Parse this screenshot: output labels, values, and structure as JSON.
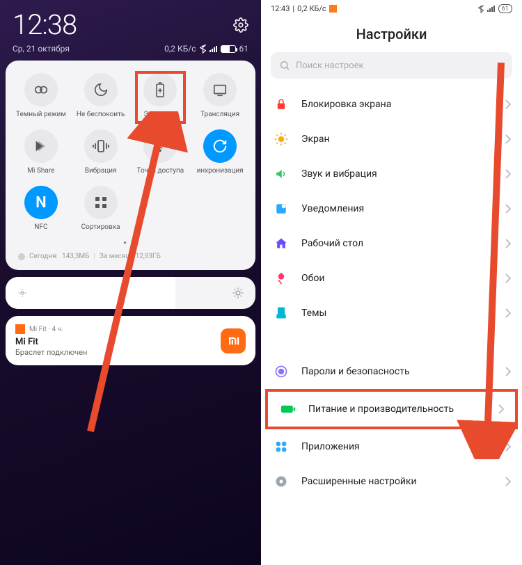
{
  "left": {
    "time": "12:38",
    "date": "Ср, 21 октября",
    "net_speed": "0,2 КБ/с",
    "battery": "61",
    "tiles": [
      {
        "id": "dark-mode",
        "label": "Темный режим",
        "active": false
      },
      {
        "id": "dnd",
        "label": "Не беспокоить",
        "active": false
      },
      {
        "id": "battery-saver",
        "label": "Экономия",
        "active": false,
        "highlight": true
      },
      {
        "id": "cast",
        "label": "Трансляция",
        "active": false
      },
      {
        "id": "mi-share",
        "label": "Mi Share",
        "active": false
      },
      {
        "id": "vibration",
        "label": "Вибрация",
        "active": false
      },
      {
        "id": "hotspot",
        "label": "Точка доступа",
        "active": false
      },
      {
        "id": "sync",
        "label": "инхронизация",
        "active": true
      },
      {
        "id": "nfc",
        "label": "NFC",
        "active": true
      },
      {
        "id": "edit",
        "label": "Сортировка",
        "active": false
      }
    ],
    "data_today_label": "Сегодня:",
    "data_today": "143,3МБ",
    "data_month_label": "За месяц:",
    "data_month": "12,93ГБ",
    "notif": {
      "app": "Mi Fit",
      "age": "4 ч.",
      "sep": "·",
      "title": "Mi Fit",
      "body": "Браслет подключен"
    }
  },
  "right": {
    "status_time": "12:43",
    "status_net": "0,2 КБ/с",
    "status_sep": "|",
    "battery": "61",
    "title": "Настройки",
    "search_placeholder": "Поиск настроек",
    "items": [
      {
        "id": "lock",
        "label": "Блокировка экрана",
        "color": "#ff3b30"
      },
      {
        "id": "display",
        "label": "Экран",
        "color": "#ffab00"
      },
      {
        "id": "sound",
        "label": "Звук и вибрация",
        "color": "#34c759"
      },
      {
        "id": "notif",
        "label": "Уведомления",
        "color": "#2aa9ff"
      },
      {
        "id": "home",
        "label": "Рабочий стол",
        "color": "#6a4cff"
      },
      {
        "id": "wallpaper",
        "label": "Обои",
        "color": "#ff3765"
      },
      {
        "id": "themes",
        "label": "Темы",
        "color": "#00b8d4"
      }
    ],
    "items2": [
      {
        "id": "security",
        "label": "Пароли и безопасность",
        "color": "#8a70ff"
      },
      {
        "id": "battery",
        "label": "Питание и производительность",
        "color": "#00c853",
        "highlight": true
      },
      {
        "id": "apps",
        "label": "Приложения",
        "color": "#2aa9ff"
      },
      {
        "id": "additional",
        "label": "Расширенные настройки",
        "color": "#9aa6b0"
      }
    ]
  }
}
